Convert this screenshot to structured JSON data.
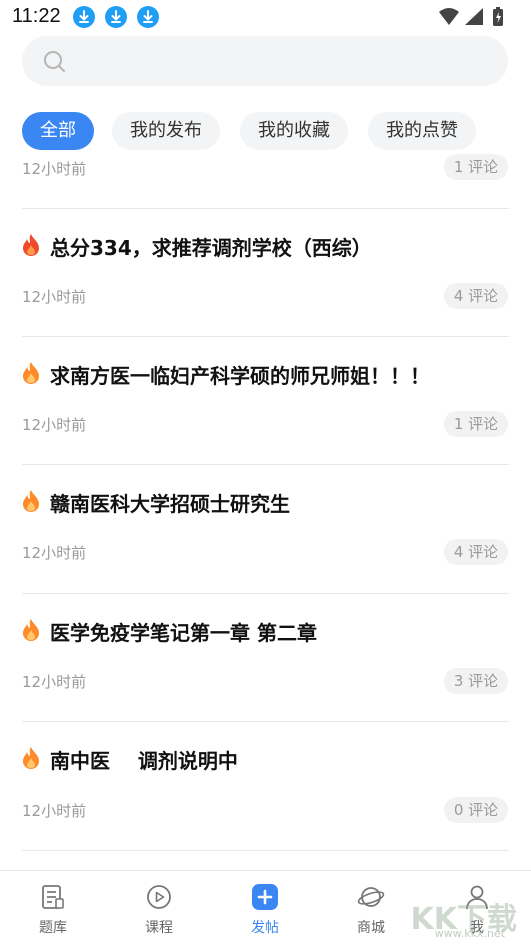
{
  "status_bar": {
    "time": "11:22",
    "icons": [
      "download-icon",
      "download-icon",
      "download-icon",
      "wifi-icon",
      "signal-icon",
      "battery-icon"
    ],
    "accent": "#1f9ff4"
  },
  "search": {
    "placeholder": "",
    "icon": "search-icon"
  },
  "filters": {
    "active_color": "#3a86f3",
    "items": [
      {
        "label": "全部",
        "active": true
      },
      {
        "label": "我的发布",
        "active": false
      },
      {
        "label": "我的收藏",
        "active": false
      },
      {
        "label": "我的点赞",
        "active": false
      }
    ]
  },
  "feed": {
    "top_partial": {
      "time": "12小时前",
      "comments": "1 评论"
    },
    "posts": [
      {
        "title": "总分334，求推荐调剂学校（西综）",
        "icon": "fire-icon",
        "time": "12小时前",
        "comments": "4 评论"
      },
      {
        "title": "求南方医一临妇产科学硕的师兄师姐！！！",
        "icon": "fire-icon",
        "time": "12小时前",
        "comments": "1 评论"
      },
      {
        "title": "赣南医科大学招硕士研究生",
        "icon": "fire-icon",
        "time": "12小时前",
        "comments": "4 评论"
      },
      {
        "title": "医学免疫学笔记第一章 第二章",
        "icon": "fire-icon",
        "time": "12小时前",
        "comments": "3 评论"
      },
      {
        "title": "南中医    调剂说明中",
        "icon": "fire-icon",
        "time": "12小时前",
        "comments": "0 评论"
      }
    ]
  },
  "bottom_nav": {
    "items": [
      {
        "label": "题库",
        "icon": "question-bank-icon",
        "active": false
      },
      {
        "label": "课程",
        "icon": "play-icon",
        "active": false
      },
      {
        "label": "发帖",
        "icon": "plus-icon",
        "active": true
      },
      {
        "label": "商城",
        "icon": "planet-icon",
        "active": false
      },
      {
        "label": "我",
        "icon": "user-icon",
        "active": false
      }
    ]
  },
  "watermark": {
    "text": "KK下载",
    "sub": "www.kkx.net"
  }
}
